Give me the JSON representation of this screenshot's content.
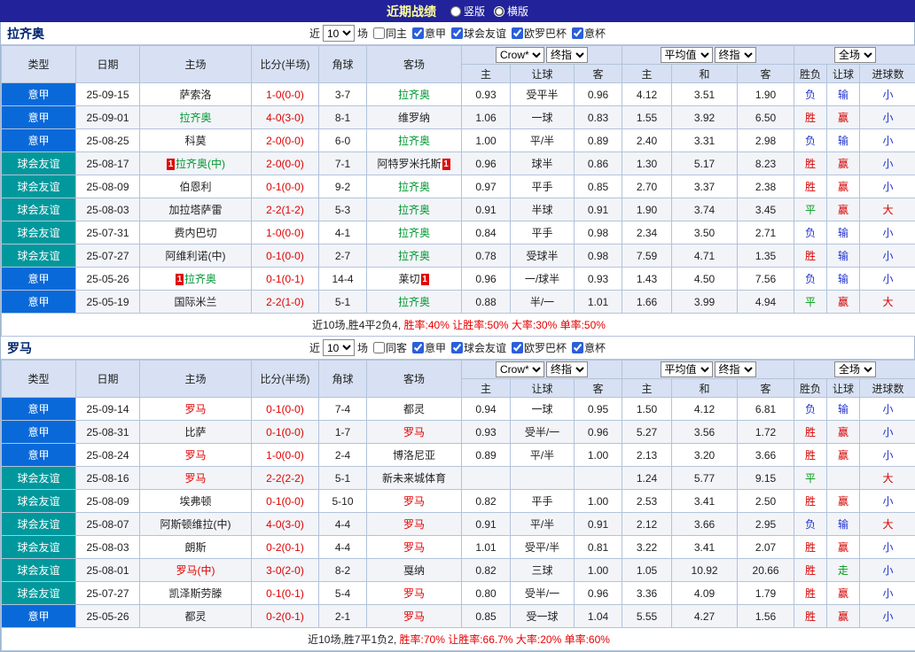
{
  "topbar": {
    "title": "近期战绩",
    "options": [
      {
        "label": "竖版",
        "selected": false
      },
      {
        "label": "横版",
        "selected": true
      }
    ]
  },
  "table_header": {
    "cols": [
      "类型",
      "日期",
      "主场",
      "比分(半场)",
      "角球",
      "客场"
    ],
    "odds_group": {
      "select1": "Crow*",
      "select2": "终指",
      "subcols": [
        "主",
        "让球",
        "客"
      ]
    },
    "avg_group": {
      "select1": "平均值",
      "select2": "终指",
      "subcols": [
        "主",
        "和",
        "客"
      ]
    },
    "result_group": {
      "select": "全场",
      "subcols": [
        "胜负",
        "让球",
        "进球数"
      ]
    }
  },
  "colors": {
    "serie_a_bg": "#0a69d9",
    "friendly_bg": "#00989c",
    "lazio_self": "#009933",
    "roma_self": "#e60000",
    "win": "#d60000",
    "draw": "#009917",
    "loss": "#2233cc",
    "score": "#e00000"
  },
  "sections": [
    {
      "team": "拉齐奥",
      "self_color": "#009933",
      "filter": {
        "near": "近",
        "count": "10",
        "games": "场",
        "same": "同主",
        "leagues": [
          "意甲",
          "球会友谊",
          "欧罗巴杯",
          "意杯"
        ]
      },
      "rows": [
        {
          "type": "意甲",
          "date": "25-09-15",
          "home": {
            "name": "萨索洛"
          },
          "score": "1-0(0-0)",
          "corner": "3-7",
          "away": {
            "name": "拉齐奥",
            "self": true
          },
          "odds": [
            "0.93",
            "受平半",
            "0.96"
          ],
          "avg": [
            "4.12",
            "3.51",
            "1.90"
          ],
          "result": [
            "负",
            "输",
            "小"
          ]
        },
        {
          "type": "意甲",
          "date": "25-09-01",
          "home": {
            "name": "拉齐奥",
            "self": true
          },
          "score": "4-0(3-0)",
          "corner": "8-1",
          "away": {
            "name": "维罗纳"
          },
          "odds": [
            "1.06",
            "一球",
            "0.83"
          ],
          "avg": [
            "1.55",
            "3.92",
            "6.50"
          ],
          "result": [
            "胜",
            "赢",
            "小"
          ]
        },
        {
          "type": "意甲",
          "date": "25-08-25",
          "home": {
            "name": "科莫"
          },
          "score": "2-0(0-0)",
          "corner": "6-0",
          "away": {
            "name": "拉齐奥",
            "self": true
          },
          "odds": [
            "1.00",
            "平/半",
            "0.89"
          ],
          "avg": [
            "2.40",
            "3.31",
            "2.98"
          ],
          "result": [
            "负",
            "输",
            "小"
          ]
        },
        {
          "type": "球会友谊",
          "date": "25-08-17",
          "home": {
            "name": "拉齐奥(中)",
            "self": true,
            "card_pre": "1"
          },
          "score": "2-0(0-0)",
          "corner": "7-1",
          "away": {
            "name": "阿特罗米托斯",
            "card_post": "1"
          },
          "odds": [
            "0.96",
            "球半",
            "0.86"
          ],
          "avg": [
            "1.30",
            "5.17",
            "8.23"
          ],
          "result": [
            "胜",
            "赢",
            "小"
          ]
        },
        {
          "type": "球会友谊",
          "date": "25-08-09",
          "home": {
            "name": "伯恩利"
          },
          "score": "0-1(0-0)",
          "corner": "9-2",
          "away": {
            "name": "拉齐奥",
            "self": true
          },
          "odds": [
            "0.97",
            "平手",
            "0.85"
          ],
          "avg": [
            "2.70",
            "3.37",
            "2.38"
          ],
          "result": [
            "胜",
            "赢",
            "小"
          ]
        },
        {
          "type": "球会友谊",
          "date": "25-08-03",
          "home": {
            "name": "加拉塔萨雷"
          },
          "score": "2-2(1-2)",
          "corner": "5-3",
          "away": {
            "name": "拉齐奥",
            "self": true
          },
          "odds": [
            "0.91",
            "半球",
            "0.91"
          ],
          "avg": [
            "1.90",
            "3.74",
            "3.45"
          ],
          "result": [
            "平",
            "赢",
            "大"
          ]
        },
        {
          "type": "球会友谊",
          "date": "25-07-31",
          "home": {
            "name": "费内巴切"
          },
          "score": "1-0(0-0)",
          "corner": "4-1",
          "away": {
            "name": "拉齐奥",
            "self": true
          },
          "odds": [
            "0.84",
            "平手",
            "0.98"
          ],
          "avg": [
            "2.34",
            "3.50",
            "2.71"
          ],
          "result": [
            "负",
            "输",
            "小"
          ]
        },
        {
          "type": "球会友谊",
          "date": "25-07-27",
          "home": {
            "name": "阿维利诺(中)"
          },
          "score": "0-1(0-0)",
          "corner": "2-7",
          "away": {
            "name": "拉齐奥",
            "self": true
          },
          "odds": [
            "0.78",
            "受球半",
            "0.98"
          ],
          "avg": [
            "7.59",
            "4.71",
            "1.35"
          ],
          "result": [
            "胜",
            "输",
            "小"
          ]
        },
        {
          "type": "意甲",
          "date": "25-05-26",
          "home": {
            "name": "拉齐奥",
            "self": true,
            "card_pre": "1"
          },
          "score": "0-1(0-1)",
          "corner": "14-4",
          "away": {
            "name": "莱切",
            "card_post": "1"
          },
          "odds": [
            "0.96",
            "一/球半",
            "0.93"
          ],
          "avg": [
            "1.43",
            "4.50",
            "7.56"
          ],
          "result": [
            "负",
            "输",
            "小"
          ]
        },
        {
          "type": "意甲",
          "date": "25-05-19",
          "home": {
            "name": "国际米兰"
          },
          "score": "2-2(1-0)",
          "corner": "5-1",
          "away": {
            "name": "拉齐奥",
            "self": true
          },
          "odds": [
            "0.88",
            "半/一",
            "1.01"
          ],
          "avg": [
            "1.66",
            "3.99",
            "4.94"
          ],
          "result": [
            "平",
            "赢",
            "大"
          ]
        }
      ],
      "summary_black": "近10场,胜4平2负4,",
      "summary_red": "胜率:40% 让胜率:50% 大率:30% 单率:50%"
    },
    {
      "team": "罗马",
      "self_color": "#e60000",
      "filter": {
        "near": "近",
        "count": "10",
        "games": "场",
        "same": "同客",
        "leagues": [
          "意甲",
          "球会友谊",
          "欧罗巴杯",
          "意杯"
        ]
      },
      "rows": [
        {
          "type": "意甲",
          "date": "25-09-14",
          "home": {
            "name": "罗马",
            "self": true
          },
          "score": "0-1(0-0)",
          "corner": "7-4",
          "away": {
            "name": "都灵"
          },
          "odds": [
            "0.94",
            "一球",
            "0.95"
          ],
          "avg": [
            "1.50",
            "4.12",
            "6.81"
          ],
          "result": [
            "负",
            "输",
            "小"
          ]
        },
        {
          "type": "意甲",
          "date": "25-08-31",
          "home": {
            "name": "比萨"
          },
          "score": "0-1(0-0)",
          "corner": "1-7",
          "away": {
            "name": "罗马",
            "self": true
          },
          "odds": [
            "0.93",
            "受半/一",
            "0.96"
          ],
          "avg": [
            "5.27",
            "3.56",
            "1.72"
          ],
          "result": [
            "胜",
            "赢",
            "小"
          ]
        },
        {
          "type": "意甲",
          "date": "25-08-24",
          "home": {
            "name": "罗马",
            "self": true
          },
          "score": "1-0(0-0)",
          "corner": "2-4",
          "away": {
            "name": "博洛尼亚"
          },
          "odds": [
            "0.89",
            "平/半",
            "1.00"
          ],
          "avg": [
            "2.13",
            "3.20",
            "3.66"
          ],
          "result": [
            "胜",
            "赢",
            "小"
          ]
        },
        {
          "type": "球会友谊",
          "date": "25-08-16",
          "home": {
            "name": "罗马",
            "self": true
          },
          "score": "2-2(2-2)",
          "corner": "5-1",
          "away": {
            "name": "新未来城体育"
          },
          "odds": [
            "",
            "",
            ""
          ],
          "avg": [
            "1.24",
            "5.77",
            "9.15"
          ],
          "result": [
            "平",
            "",
            "大"
          ]
        },
        {
          "type": "球会友谊",
          "date": "25-08-09",
          "home": {
            "name": "埃弗顿"
          },
          "score": "0-1(0-0)",
          "corner": "5-10",
          "away": {
            "name": "罗马",
            "self": true
          },
          "odds": [
            "0.82",
            "平手",
            "1.00"
          ],
          "avg": [
            "2.53",
            "3.41",
            "2.50"
          ],
          "result": [
            "胜",
            "赢",
            "小"
          ]
        },
        {
          "type": "球会友谊",
          "date": "25-08-07",
          "home": {
            "name": "阿斯顿维拉(中)"
          },
          "score": "4-0(3-0)",
          "corner": "4-4",
          "away": {
            "name": "罗马",
            "self": true
          },
          "odds": [
            "0.91",
            "平/半",
            "0.91"
          ],
          "avg": [
            "2.12",
            "3.66",
            "2.95"
          ],
          "result": [
            "负",
            "输",
            "大"
          ]
        },
        {
          "type": "球会友谊",
          "date": "25-08-03",
          "home": {
            "name": "朗斯"
          },
          "score": "0-2(0-1)",
          "corner": "4-4",
          "away": {
            "name": "罗马",
            "self": true
          },
          "odds": [
            "1.01",
            "受平/半",
            "0.81"
          ],
          "avg": [
            "3.22",
            "3.41",
            "2.07"
          ],
          "result": [
            "胜",
            "赢",
            "小"
          ]
        },
        {
          "type": "球会友谊",
          "date": "25-08-01",
          "home": {
            "name": "罗马(中)",
            "self": true
          },
          "score": "3-0(2-0)",
          "corner": "8-2",
          "away": {
            "name": "戛纳"
          },
          "odds": [
            "0.82",
            "三球",
            "1.00"
          ],
          "avg": [
            "1.05",
            "10.92",
            "20.66"
          ],
          "result": [
            "胜",
            "走",
            "小"
          ]
        },
        {
          "type": "球会友谊",
          "date": "25-07-27",
          "home": {
            "name": "凯泽斯劳滕"
          },
          "score": "0-1(0-1)",
          "corner": "5-4",
          "away": {
            "name": "罗马",
            "self": true
          },
          "odds": [
            "0.80",
            "受半/一",
            "0.96"
          ],
          "avg": [
            "3.36",
            "4.09",
            "1.79"
          ],
          "result": [
            "胜",
            "赢",
            "小"
          ]
        },
        {
          "type": "意甲",
          "date": "25-05-26",
          "home": {
            "name": "都灵"
          },
          "score": "0-2(0-1)",
          "corner": "2-1",
          "away": {
            "name": "罗马",
            "self": true
          },
          "odds": [
            "0.85",
            "受一球",
            "1.04"
          ],
          "avg": [
            "5.55",
            "4.27",
            "1.56"
          ],
          "result": [
            "胜",
            "赢",
            "小"
          ]
        }
      ],
      "summary_black": "近10场,胜7平1负2,",
      "summary_red": "胜率:70% 让胜率:66.7% 大率:20% 单率:60%"
    }
  ]
}
